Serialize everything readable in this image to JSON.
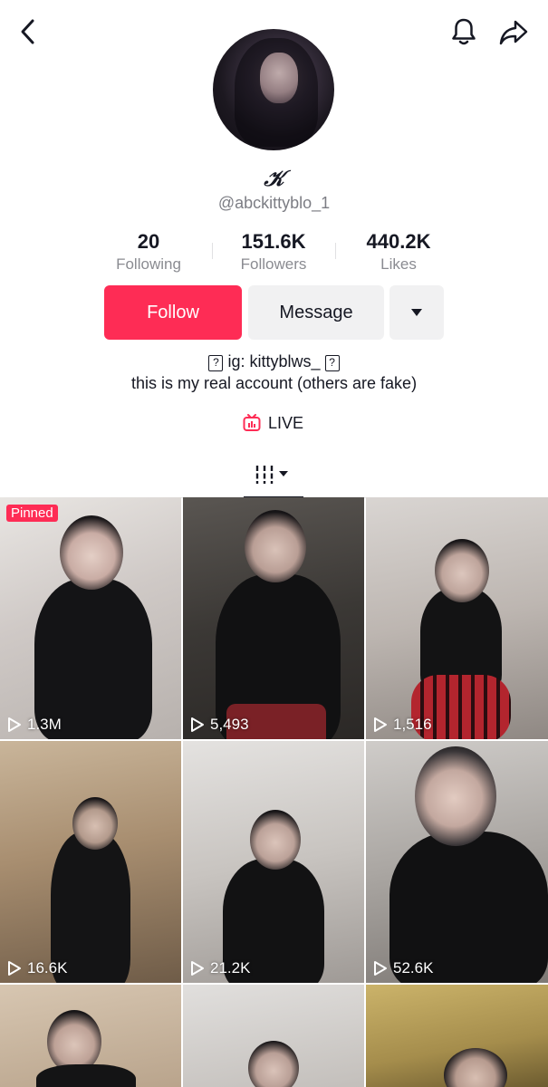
{
  "profile": {
    "name": "𝒦",
    "handle": "@abckittyblo_1"
  },
  "stats": [
    {
      "value": "20",
      "label": "Following"
    },
    {
      "value": "151.6K",
      "label": "Followers"
    },
    {
      "value": "440.2K",
      "label": "Likes"
    }
  ],
  "actions": {
    "follow_label": "Follow",
    "message_label": "Message"
  },
  "bio": {
    "line1_symbol": "?",
    "line1_text": "ig: kittyblws_",
    "line2": "this is my real account (others are fake)"
  },
  "live": {
    "label": "LIVE"
  },
  "videos": [
    {
      "views": "1.3M",
      "pinned_label": "Pinned"
    },
    {
      "views": "5,493"
    },
    {
      "views": "1,516"
    },
    {
      "views": "16.6K"
    },
    {
      "views": "21.2K"
    },
    {
      "views": "52.6K"
    },
    {
      "views": ""
    },
    {
      "views": ""
    },
    {
      "views": ""
    }
  ],
  "colors": {
    "accent": "#fe2c55",
    "text": "#161823",
    "secondary_text": "#7c7d84",
    "button_gray": "#f1f1f2"
  },
  "icons": {
    "back": "chevron-left-icon",
    "bell": "bell-icon",
    "share": "share-arrow-icon",
    "more": "caret-down-icon",
    "live": "tv-live-icon",
    "grid_tab": "grid-columns-icon",
    "play": "play-outline-icon"
  }
}
